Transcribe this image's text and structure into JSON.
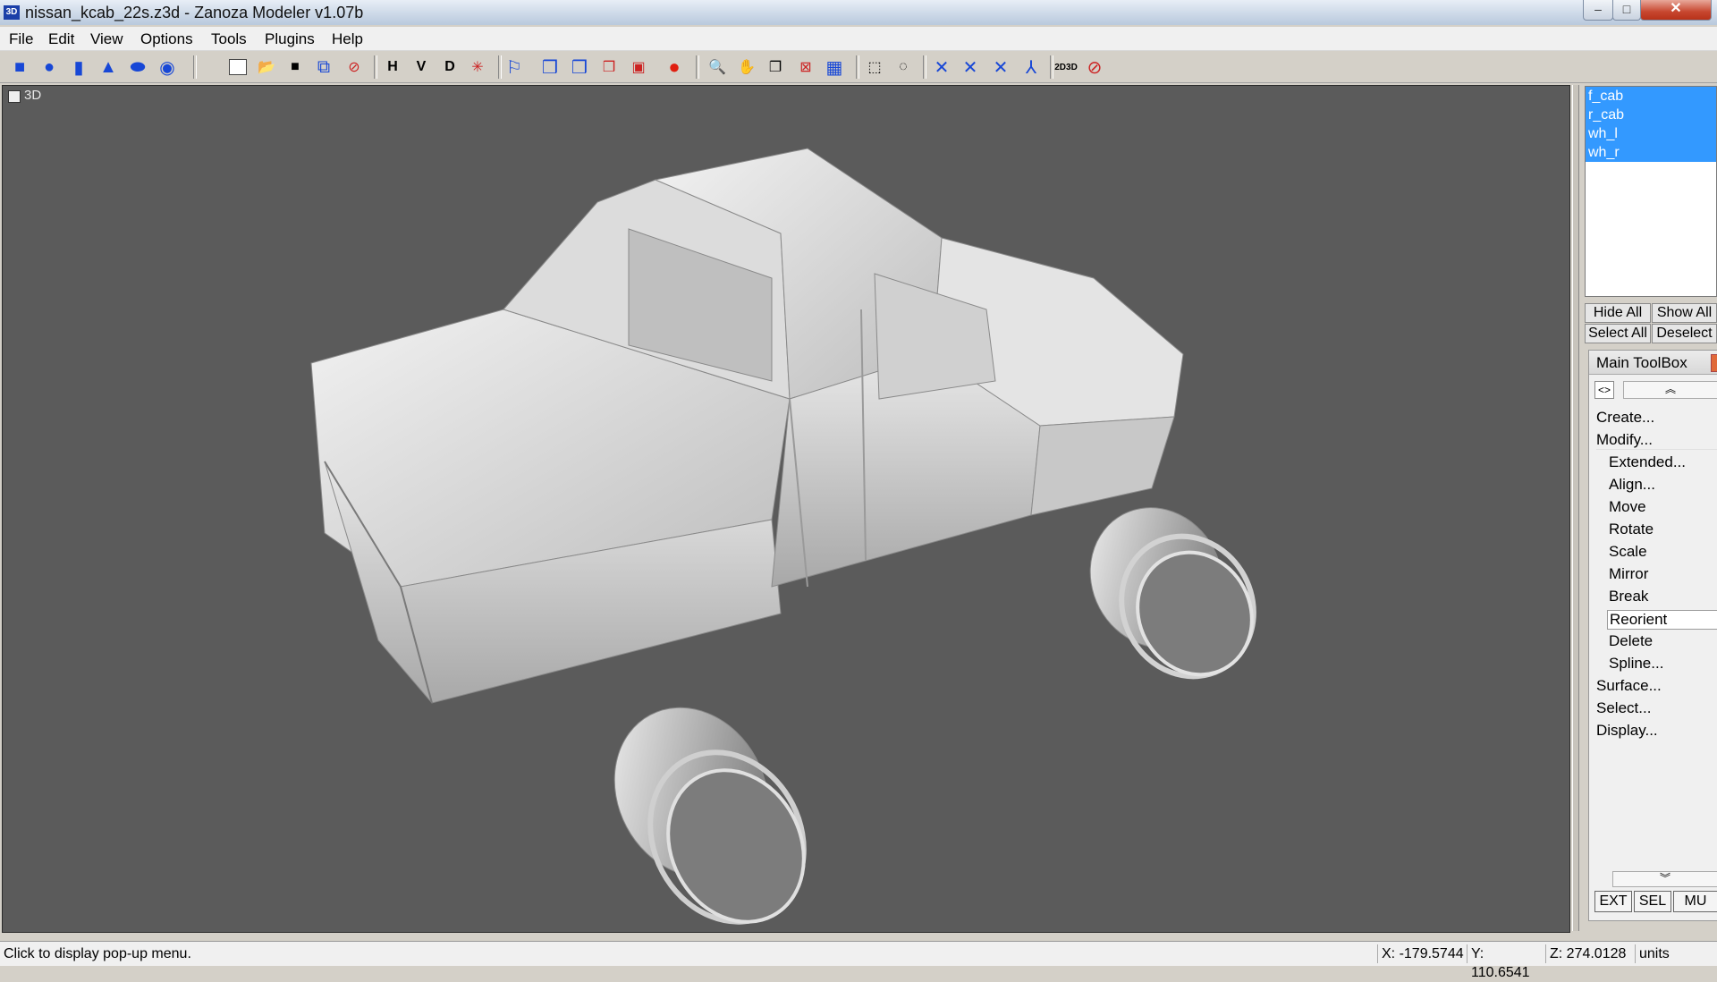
{
  "window": {
    "title": "nissan_kcab_22s.z3d - Zanoza Modeler v1.07b",
    "app_icon_text": "3D",
    "min": "–",
    "max": "□",
    "close": "✕"
  },
  "menu": [
    "File",
    "Edit",
    "View",
    "Options",
    "Tools",
    "Plugins",
    "Help"
  ],
  "toolbar": {
    "letters": [
      "H",
      "V",
      "D"
    ],
    "icons": [
      "box-icon",
      "sphere-icon",
      "cylinder-icon",
      "cone-icon",
      "torus-icon",
      "tube-icon",
      "new-icon",
      "open-icon",
      "save-icon",
      "save-as-icon",
      "close-file-icon",
      "render-icon",
      "zoom-icon",
      "pan-icon",
      "view-cube-icon",
      "rotate-view-icon",
      "camera-icon",
      "select-region-icon",
      "select-circle-icon",
      "axis-icon",
      "label-2d3d-icon",
      "no-icon"
    ]
  },
  "viewport": {
    "label": "3D",
    "background": "#5b5b5b"
  },
  "objects": [
    "f_cab",
    "r_cab",
    "wh_l",
    "wh_r"
  ],
  "panel_buttons": {
    "hide_all": "Hide All",
    "show_all": "Show All",
    "select_all": "Select All",
    "deselect": "Deselect"
  },
  "toolbox": {
    "title": "Main ToolBox",
    "items": [
      "Create...",
      "Modify...",
      "Extended...",
      "Align...",
      "Move",
      "Rotate",
      "Scale",
      "Mirror",
      "Break",
      "Reorient",
      "Delete",
      "Spline...",
      "Surface...",
      "Select...",
      "Display..."
    ],
    "bottom": [
      "EXT",
      "SEL",
      "MU"
    ]
  },
  "status": {
    "message": "Click to display pop-up menu.",
    "x": "X: -179.5744",
    "y": "Y: 110.6541",
    "z": "Z: 274.0128",
    "units": "units"
  },
  "colors": {
    "selection": "#3399ff",
    "close_button": "#c7462f"
  }
}
